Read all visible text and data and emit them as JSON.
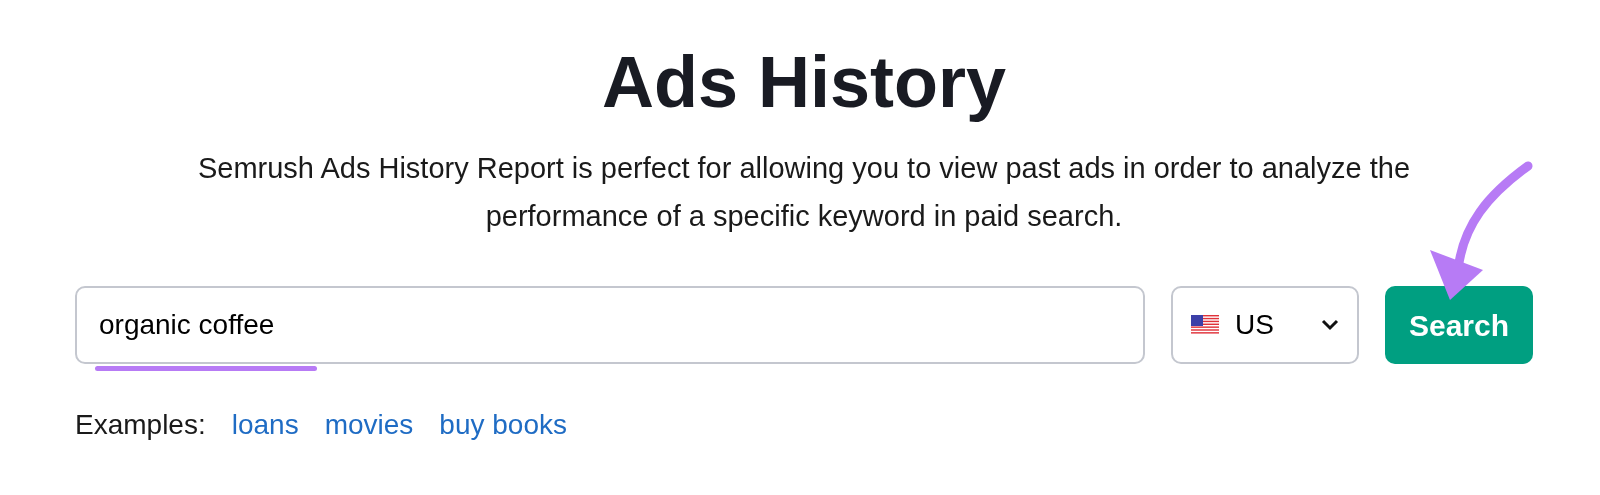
{
  "title": "Ads History",
  "description": "Semrush Ads History Report is perfect for allowing you to view past ads in order to analyze the performance of a specific keyword in paid search.",
  "search": {
    "value": "organic coffee",
    "underlined": true
  },
  "country": {
    "label": "US"
  },
  "button": "Search",
  "examples": {
    "label": "Examples:",
    "links": [
      "loans",
      "movies",
      "buy books"
    ]
  }
}
